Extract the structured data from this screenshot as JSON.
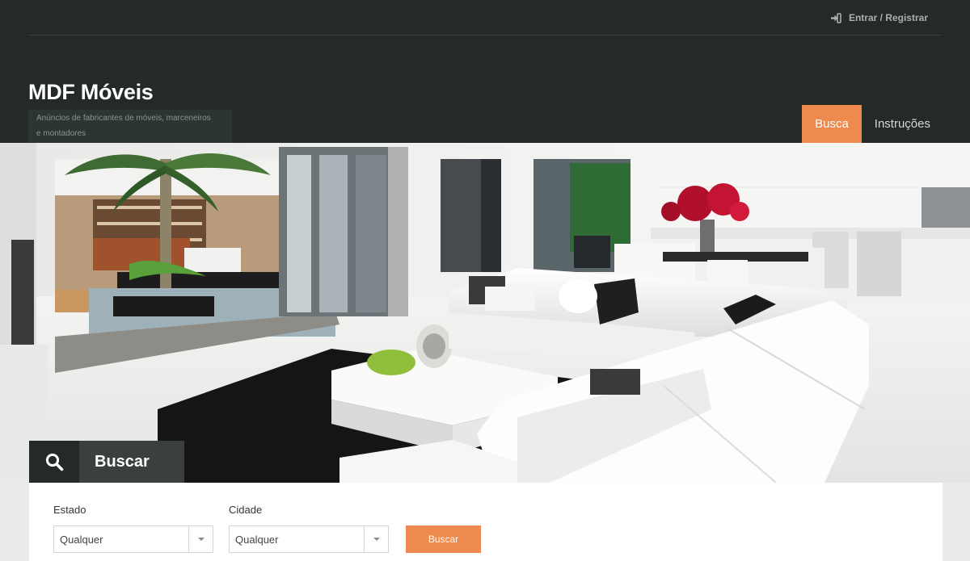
{
  "header": {
    "login_label": "Entrar / Registrar",
    "login_icon": "sign-in-icon",
    "site_title": "MDF Móveis",
    "tagline_line1": "Anúncios de fabricantes de móveis, marceneiros",
    "tagline_line2": "e montadores",
    "nav": {
      "busca": "Busca",
      "instrucoes": "Instruções"
    }
  },
  "search": {
    "tab_label": "Buscar",
    "tab_icon": "search-icon",
    "estado_label": "Estado",
    "estado_value": "Qualquer",
    "cidade_label": "Cidade",
    "cidade_value": "Qualquer",
    "submit_label": "Buscar"
  },
  "colors": {
    "header_bg": "#232a29",
    "accent": "#ee8a4d",
    "panel_bg": "#ffffff"
  }
}
